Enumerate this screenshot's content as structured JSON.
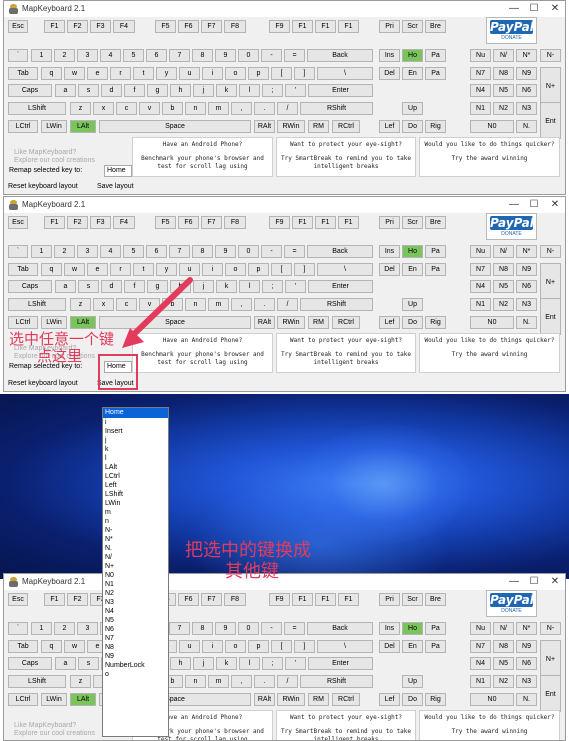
{
  "app": {
    "title": "MapKeyboard 2.1"
  },
  "window_controls": {
    "minimize": "—",
    "maximize": "☐",
    "close": "✕"
  },
  "keys": {
    "esc": "Esc",
    "f1": "F1",
    "f2": "F2",
    "f3": "F3",
    "f4": "F4",
    "f5": "F5",
    "f6": "F6",
    "f7": "F7",
    "f8": "F8",
    "f9": "F9",
    "f10": "F1",
    "f11": "F1",
    "f12": "F1",
    "prt": "Pri",
    "scr": "Scr",
    "brk": "Bre",
    "tilde": "`",
    "d1": "1",
    "d2": "2",
    "d3": "3",
    "d4": "4",
    "d5": "5",
    "d6": "6",
    "d7": "7",
    "d8": "8",
    "d9": "9",
    "d0": "0",
    "minus": "-",
    "equal": "=",
    "back": "Back",
    "ins": "Ins",
    "home": "Ho",
    "pgup": "Pa",
    "nu": "Nu",
    "ndiv": "N/",
    "nmul": "N*",
    "nsub": "N-",
    "tab": "Tab",
    "q": "q",
    "w": "w",
    "e": "e",
    "r": "r",
    "t": "t",
    "y": "y",
    "u": "u",
    "i": "i",
    "o": "o",
    "p": "p",
    "lbr": "[",
    "rbr": "]",
    "bsl": "\\",
    "del": "Del",
    "end": "En",
    "pgdn": "Pa",
    "n7": "N7",
    "n8": "N8",
    "n9": "N9",
    "nadd": "N+",
    "caps": "Caps",
    "a": "a",
    "s": "s",
    "d": "d",
    "f": "f",
    "g": "g",
    "h": "h",
    "j": "j",
    "k": "k",
    "l": "l",
    "semi": ";",
    "quote": "'",
    "enter": "Enter",
    "n4": "N4",
    "n5": "N5",
    "n6": "N6",
    "lshift": "LShift",
    "z": "z",
    "x": "x",
    "c": "c",
    "v": "v",
    "b": "b",
    "n": "n",
    "m": "m",
    "comma": ",",
    "period": ".",
    "slash": "/",
    "rshift": "RShift",
    "up": "Up",
    "n1": "N1",
    "n2": "N2",
    "n3": "N3",
    "nent": "Ent",
    "lctrl": "LCtrl",
    "lwin": "LWin",
    "lalt": "LAlt",
    "space": "Space",
    "ralt": "RAlt",
    "rwin": "RWin",
    "rm": "RM",
    "rctrl": "RCtrl",
    "left": "Lef",
    "down": "Do",
    "right": "Rig",
    "n0": "N0",
    "ndot": "N."
  },
  "paypal": {
    "logo": "PayPal",
    "donate": "DONATE"
  },
  "ads": {
    "android_title": "Have an Android Phone?",
    "android_body": "Benchmark your phone's browser and test for scroll lag using",
    "eye_title": "Want to protect your eye-sight?",
    "eye_body": "Try SmartBreak to remind you to take intelligent breaks",
    "quick_title": "Would you like to do things quicker?",
    "quick_body": "Try the award winning"
  },
  "like": {
    "line1": "Like MapKeyboard?",
    "line2": "Explore our cool creations"
  },
  "remap": {
    "label": "Remap selected key to:",
    "value": "Home"
  },
  "buttons": {
    "reset": "Reset keyboard layout",
    "save": "Save layout"
  },
  "dropdown": {
    "selected": "Home",
    "options": [
      "i",
      "Insert",
      "j",
      "k",
      "l",
      "LAlt",
      "LCtrl",
      "Left",
      "LShift",
      "LWin",
      "m",
      "n",
      "N-",
      "N*",
      "N.",
      "N/",
      "N+",
      "N0",
      "N1",
      "N2",
      "N3",
      "N4",
      "N5",
      "N6",
      "N7",
      "N8",
      "N9",
      "NumberLock",
      "o"
    ]
  },
  "annotations": {
    "step1_line1": "选中任意一个键",
    "step1_line2": "点这里",
    "step2_line1": "把选中的键换成",
    "step2_line2": "其他键"
  },
  "colors": {
    "active_key": "#7bc35b",
    "annotation": "#e23b5c",
    "selection": "#0a64d8",
    "paypal": "#1f66b3"
  }
}
